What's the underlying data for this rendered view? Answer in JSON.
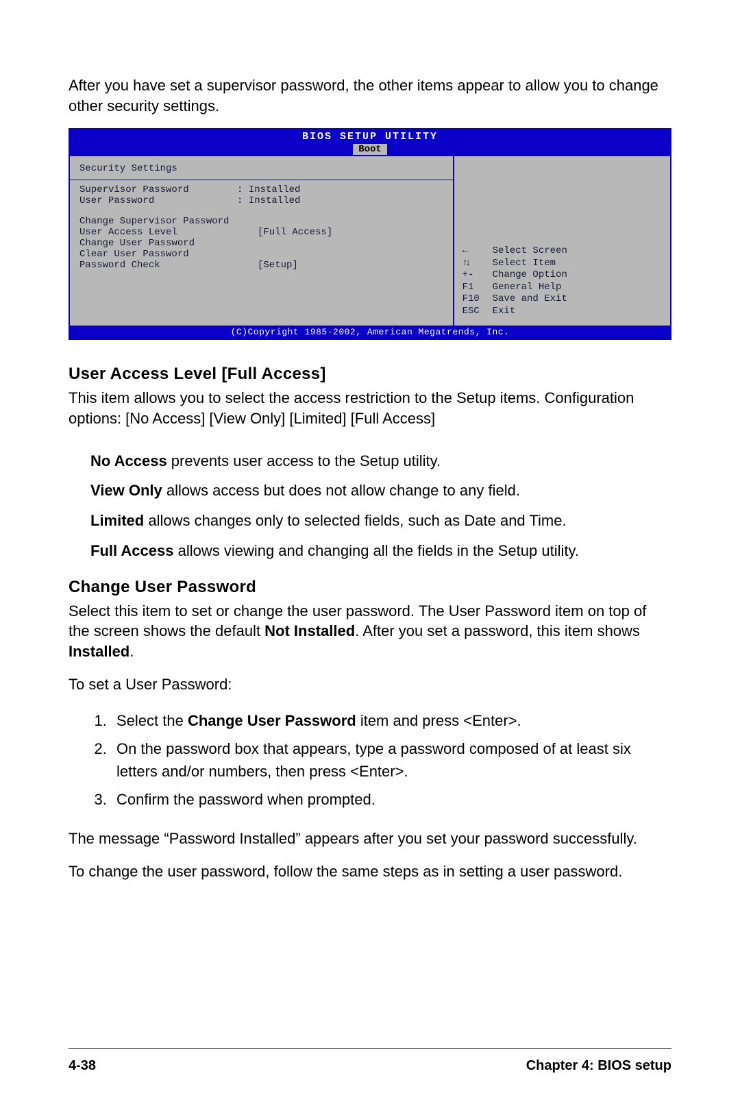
{
  "intro": "After you have set a supervisor password, the other items appear to allow you to change other security settings.",
  "bios": {
    "title": "BIOS SETUP UTILITY",
    "tab": "Boot",
    "section_title": "Security Settings",
    "status": [
      {
        "label": "Supervisor Password",
        "value": ": Installed"
      },
      {
        "label": "User Password",
        "value": ": Installed"
      }
    ],
    "items": [
      {
        "label": "Change Supervisor Password",
        "value": ""
      },
      {
        "label": "User Access Level",
        "value": "[Full Access]"
      },
      {
        "label": "Change User Password",
        "value": ""
      },
      {
        "label": "Clear User Password",
        "value": ""
      },
      {
        "label": "Password Check",
        "value": "[Setup]"
      }
    ],
    "help": {
      "select_screen": "Select Screen",
      "select_item": "Select Item",
      "change_option": "Change Option",
      "general_help": "General Help",
      "save_exit": "Save and Exit",
      "exit": "Exit",
      "keys": {
        "plus_minus": "+-",
        "f1": "F1",
        "f10": "F10",
        "esc": "ESC"
      }
    },
    "footer": "(C)Copyright 1985-2002, American Megatrends, Inc."
  },
  "ual": {
    "heading": "User Access Level [Full Access]",
    "p1": "This item allows you to select the access restriction to the Setup items. Configuration options: [No Access] [View Only] [Limited] [Full Access]",
    "opts": [
      {
        "lead": "No Access",
        "text": " prevents user access to the Setup utility."
      },
      {
        "lead": "View Only",
        "text": " allows access but does not allow change to any field."
      },
      {
        "lead": "Limited",
        "text": " allows changes only to selected fields, such as Date and Time."
      },
      {
        "lead": "Full Access",
        "text": " allows viewing and changing all the fields in the Setup utility."
      }
    ]
  },
  "cup": {
    "heading": "Change User Password",
    "p1a": "Select this item to set or change the user password. The User Password item on top of the screen shows the default ",
    "p1b": "Not Installed",
    "p1c": ". After you set a password, this item shows ",
    "p1d": "Installed",
    "p1e": ".",
    "p2": "To set a User Password:",
    "steps": {
      "s1a": "Select the ",
      "s1b": "Change User Password",
      "s1c": " item and press <Enter>.",
      "s2": "On the password box that appears, type a password composed of at least six letters and/or numbers, then press <Enter>.",
      "s3": "Confirm the password when prompted."
    },
    "p3": "The message “Password Installed” appears after you set your password successfully.",
    "p4": "To change the user password, follow the same steps as in setting a user password."
  },
  "footer": {
    "left": "4-38",
    "right": "Chapter 4: BIOS setup"
  }
}
